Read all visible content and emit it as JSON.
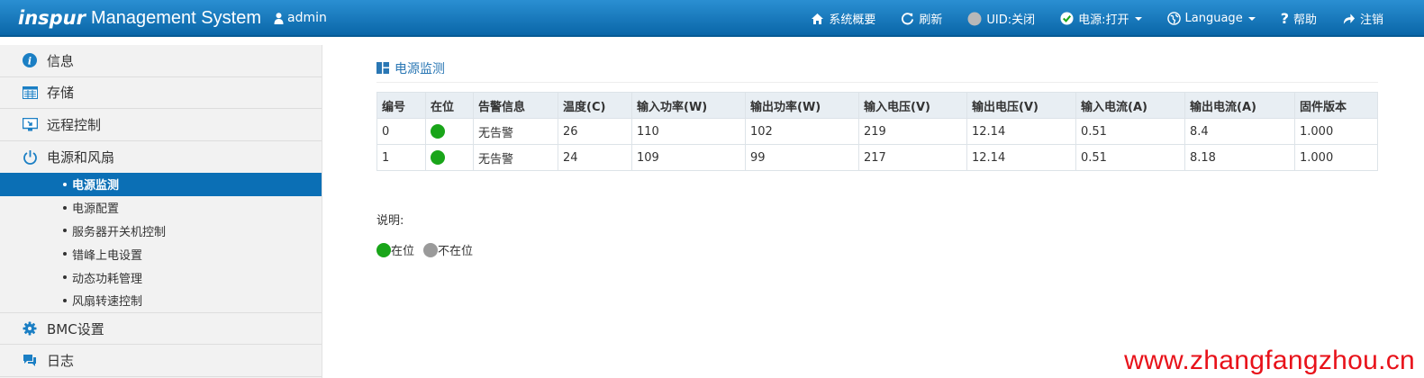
{
  "header": {
    "logo": "inspur",
    "title": "Management System",
    "user": "admin",
    "nav": [
      {
        "label": "系统概要",
        "icon": "home-icon"
      },
      {
        "label": "刷新",
        "icon": "refresh-icon"
      },
      {
        "label": "UID:关闭",
        "icon": "uid-icon"
      },
      {
        "label": "电源:打开",
        "icon": "power-check-icon"
      },
      {
        "label": "Language",
        "icon": "globe-icon"
      },
      {
        "label": "帮助",
        "icon": "help-icon"
      },
      {
        "label": "注销",
        "icon": "logout-icon"
      }
    ]
  },
  "sidebar": {
    "items": [
      {
        "label": "信息",
        "icon": "info-icon"
      },
      {
        "label": "存储",
        "icon": "storage-icon"
      },
      {
        "label": "远程控制",
        "icon": "remote-control-icon"
      },
      {
        "label": "电源和风扇",
        "icon": "power-icon"
      }
    ],
    "sub_items": [
      "电源监测",
      "电源配置",
      "服务器开关机控制",
      "错峰上电设置",
      "动态功耗管理",
      "风扇转速控制"
    ],
    "bottom_items": [
      {
        "label": "BMC设置",
        "icon": "gear-icon"
      },
      {
        "label": "日志",
        "icon": "log-icon"
      }
    ]
  },
  "main": {
    "title": "电源监测",
    "columns": [
      "编号",
      "在位",
      "告警信息",
      "温度(C)",
      "输入功率(W)",
      "输出功率(W)",
      "输入电压(V)",
      "输出电压(V)",
      "输入电流(A)",
      "输出电流(A)",
      "固件版本"
    ],
    "rows": [
      [
        "0",
        "",
        "无告警",
        "26",
        "110",
        "102",
        "219",
        "12.14",
        "0.51",
        "8.4",
        "1.000"
      ],
      [
        "1",
        "",
        "无告警",
        "24",
        "109",
        "99",
        "217",
        "12.14",
        "0.51",
        "8.18",
        "1.000"
      ]
    ],
    "legend_title": "说明:",
    "legend": {
      "present": "在位",
      "absent": "不在位"
    }
  },
  "colors": {
    "present": "#19a519",
    "absent": "#9a9a9a",
    "accent": "#0b6fb5"
  },
  "watermark": "www.zhangfangzhou.cn"
}
